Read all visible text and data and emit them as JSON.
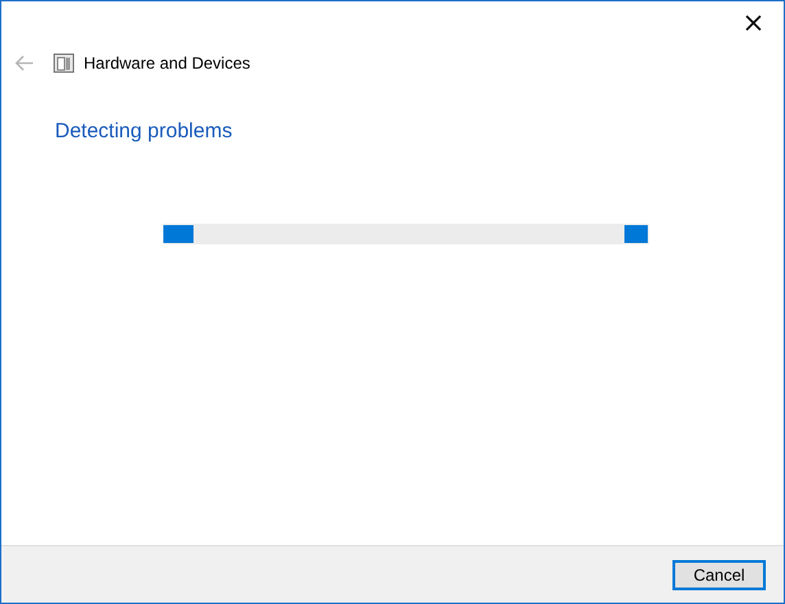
{
  "window": {
    "close_glyph": "×"
  },
  "header": {
    "title": "Hardware and Devices"
  },
  "heading": "Detecting problems",
  "progress": {
    "indeterminate": true
  },
  "buttons": [
    {
      "label": "Cancel",
      "kind": "default"
    }
  ]
}
